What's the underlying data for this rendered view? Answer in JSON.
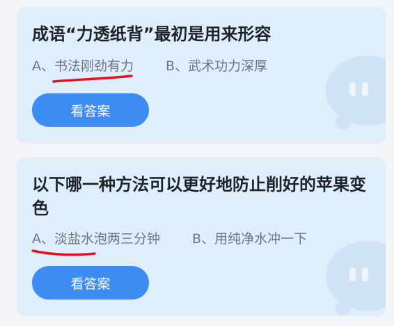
{
  "cards": [
    {
      "question": "成语“力透纸背”最初是用来形容",
      "options": [
        "A、书法刚劲有力",
        "B、武术功力深厚"
      ],
      "button_label": "看答案"
    },
    {
      "question": "以下哪一种方法可以更好地防止削好的苹果变色",
      "options": [
        "A、淡盐水泡两三分钟",
        "B、用纯净水冲一下"
      ],
      "button_label": "看答案"
    }
  ],
  "colors": {
    "page_background": "#f3f5f9",
    "card_background": "#dfeefb",
    "button": "#3c8cf4",
    "underline_mark": "#e8101c"
  },
  "icons": [
    "chat-bubble-icon",
    "chat-bubble-icon"
  ]
}
